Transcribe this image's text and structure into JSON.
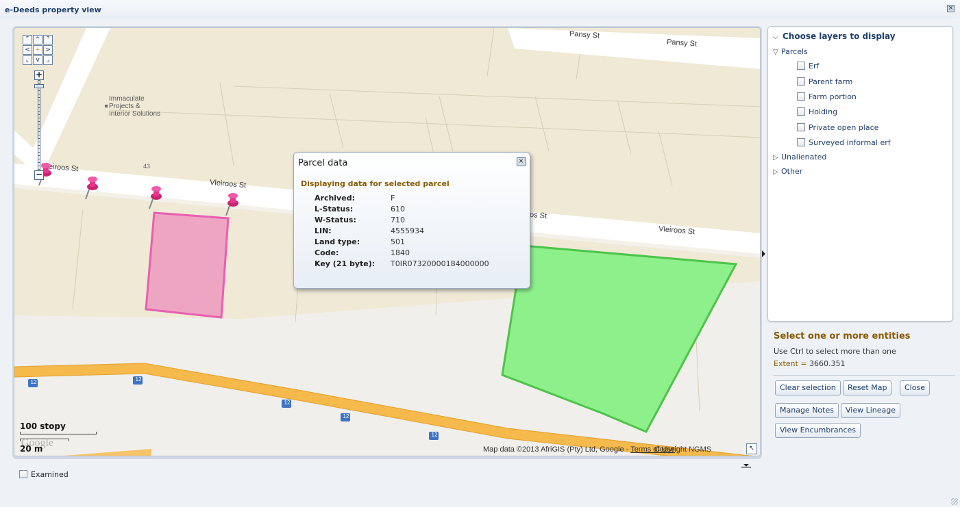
{
  "window": {
    "title": "e-Deeds property view",
    "close_glyph": "×"
  },
  "map": {
    "streets": {
      "pansy_1": "Pansy St",
      "pansy_2": "Pansy St",
      "vleiroos_1": "Vleiroos St",
      "vleiroos_2": "Vleiroos St",
      "vleiroos_partial_left": "Vleiroos St",
      "vleiroos_partial_mid": "os St",
      "number_43": "43",
      "route_12": "12"
    },
    "poi": {
      "line1": "Immaculate",
      "line2": "Projects &",
      "line3": "Interior Solutions"
    },
    "scale": {
      "top": "100 stopy",
      "bottom": "20 m"
    },
    "logo_text": "Google",
    "attribution": {
      "prefix": "Map data ©2013 AfriGIS (Pty) Ltd, Google - ",
      "terms": "Terms of Use",
      "overlap": "Copyright NGMS"
    },
    "colors": {
      "land": "#efe9d6",
      "road": "#ffffff",
      "highway": "#f6b94b",
      "selected_parcel": "#eea5c2",
      "selected_parcel_border": "#e85fb1",
      "green_parcel": "#8ef08a",
      "green_parcel_border": "#4cc44a",
      "pin": "#e8358f"
    }
  },
  "popup": {
    "title": "Parcel data",
    "subtitle": "Displaying data for selected parcel",
    "rows": [
      {
        "key": "Archived:",
        "value": "F"
      },
      {
        "key": "L-Status:",
        "value": "610"
      },
      {
        "key": "W-Status:",
        "value": "710"
      },
      {
        "key": "LIN:",
        "value": "4555934"
      },
      {
        "key": "Land type:",
        "value": "501"
      },
      {
        "key": "Code:",
        "value": "1840"
      },
      {
        "key": "Key (21 byte):",
        "value": "T0IR07320000184000000"
      }
    ]
  },
  "layers": {
    "heading": "Choose layers to display",
    "parcels_label": "Parcels",
    "parcel_children": [
      "Erf",
      "Parent farm",
      "Farm portion",
      "Holding",
      "Private open place",
      "Surveyed informal erf"
    ],
    "unalienated_label": "Unalienated",
    "other_label": "Other"
  },
  "selection": {
    "title": "Select one or more entities",
    "hint": "Use Ctrl to select more than one",
    "extent_label": "Extent = ",
    "extent_value": "3660.351"
  },
  "buttons": {
    "clear_selection": "Clear selection",
    "reset_map": "Reset Map",
    "close": "Close",
    "manage_notes": "Manage Notes",
    "view_lineage": "View Lineage",
    "view_encumbrances": "View Encumbrances"
  },
  "examined": {
    "label": "Examined"
  }
}
